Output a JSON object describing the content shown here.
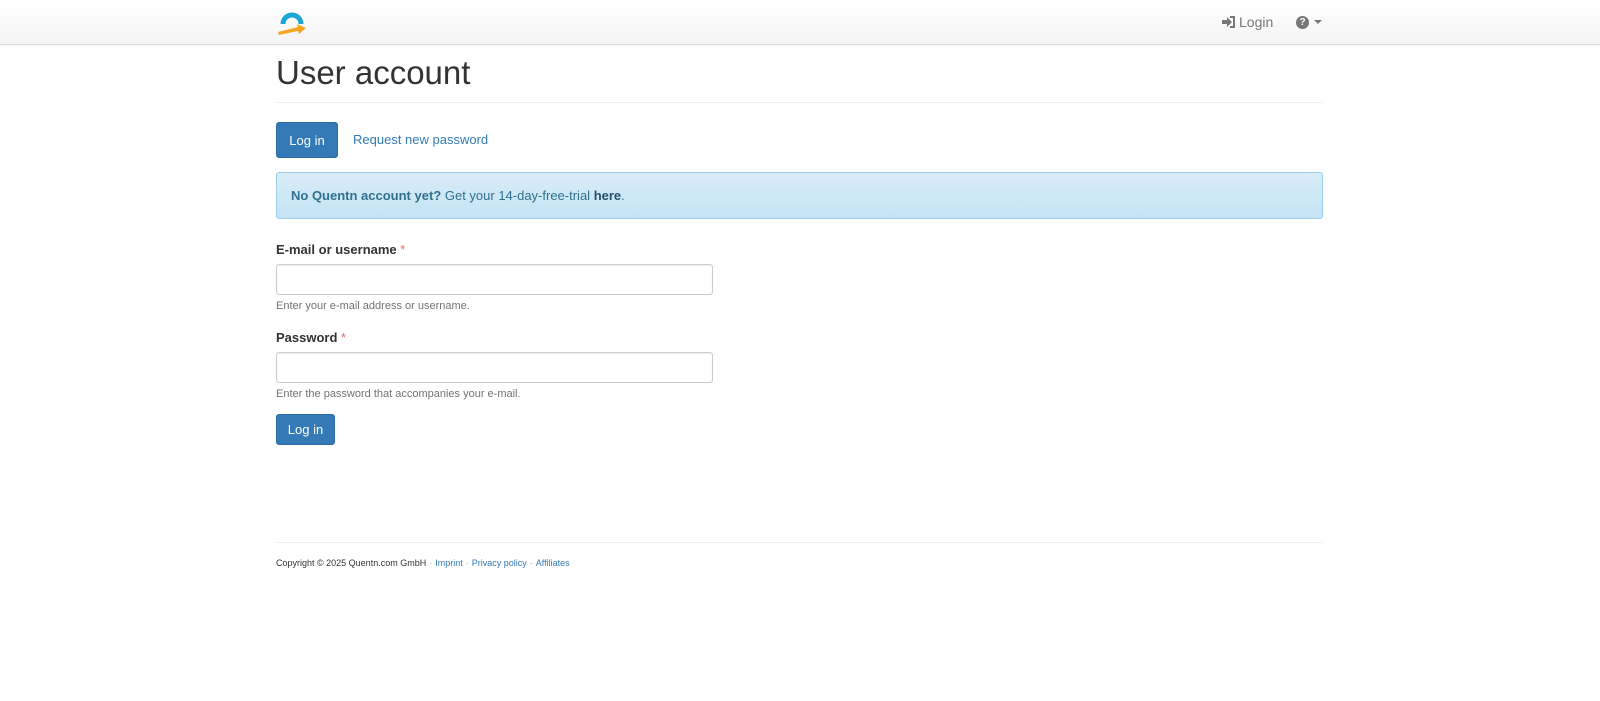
{
  "navbar": {
    "login_label": "Login",
    "login_icon": "sign-in-icon",
    "help_icon": "question-circle-icon",
    "logo_colors": {
      "arc": "#1ea7d6",
      "arrow": "#f5a623"
    }
  },
  "page": {
    "title": "User account"
  },
  "tabs": {
    "active_label": "Log in",
    "secondary_label": "Request new password"
  },
  "alert": {
    "bold_text": "No Quentn account yet?",
    "text": " Get your 14-day-free-trial ",
    "link_text": "here",
    "end": "."
  },
  "form": {
    "username_label": "E-mail or username",
    "username_required": "*",
    "username_value": "",
    "username_help": "Enter your e-mail address or username.",
    "password_label": "Password",
    "password_required": "*",
    "password_value": "",
    "password_help": "Enter the password that accompanies your e-mail.",
    "submit_label": "Log in"
  },
  "footer": {
    "copyright": "Copyright © 2025 Quentn.com GmbH",
    "separator": "·",
    "links": [
      "Imprint",
      "Privacy policy",
      "Affiliates"
    ]
  }
}
